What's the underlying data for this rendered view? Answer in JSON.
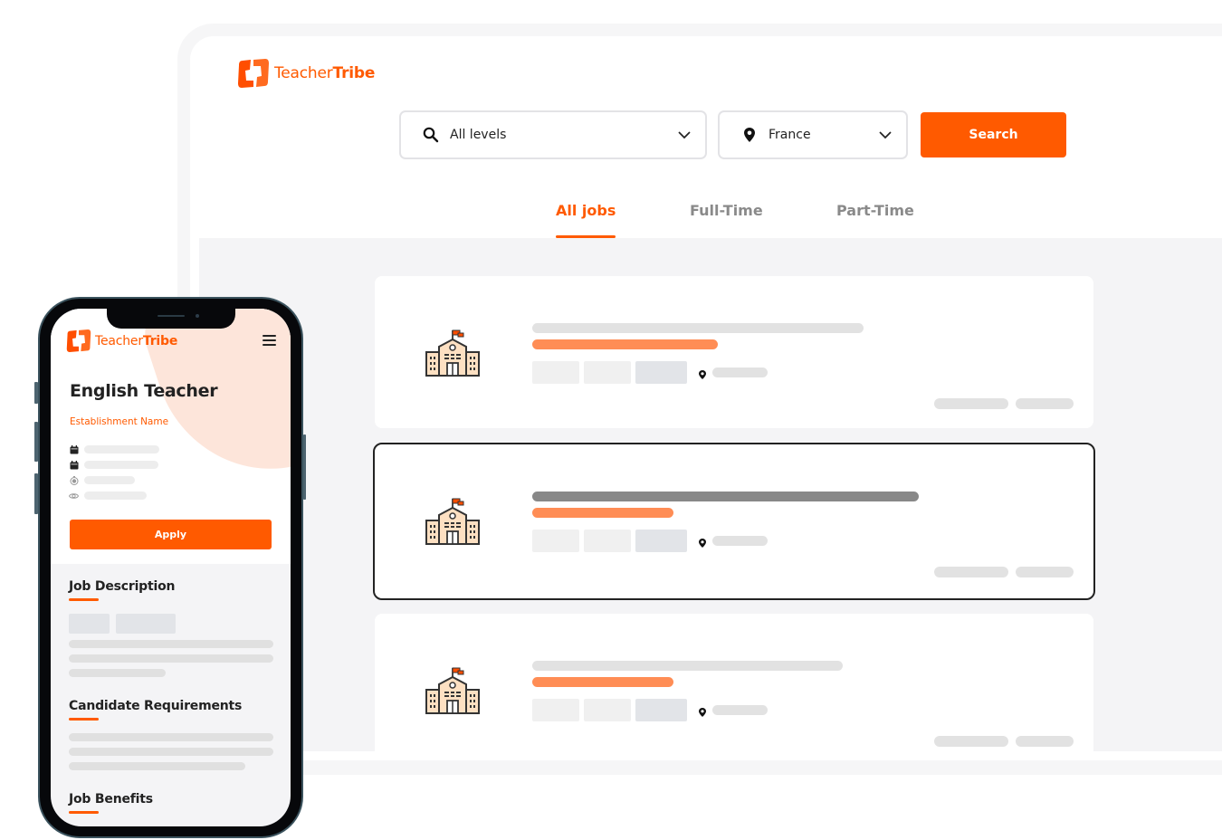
{
  "brand": {
    "name_light": "Teacher",
    "name_bold": "Tribe",
    "accent_color": "#ff5a00"
  },
  "desktop": {
    "search": {
      "level_icon": "search-icon",
      "level_value": "All levels",
      "country_icon": "location-pin-icon",
      "country_value": "France",
      "dropdown_icon": "chevron-down-icon",
      "search_label": "Search"
    },
    "tabs": [
      {
        "label": "All jobs",
        "active": true
      },
      {
        "label": "Full-Time",
        "active": false
      },
      {
        "label": "Part-Time",
        "active": false
      }
    ],
    "job_cards": [
      {
        "icon": "school-building-icon",
        "selected": false,
        "placeholder": true
      },
      {
        "icon": "school-building-icon",
        "selected": true,
        "placeholder": true
      },
      {
        "icon": "school-building-icon",
        "selected": false,
        "placeholder": true
      }
    ]
  },
  "phone": {
    "menu_icon": "hamburger-menu-icon",
    "job_title": "English Teacher",
    "establishment": "Establishment Name",
    "meta_icons": [
      "calendar-icon",
      "calendar-icon",
      "clock-icon",
      "eye-icon"
    ],
    "apply_label": "Apply",
    "sections": [
      {
        "title": "Job Description"
      },
      {
        "title": "Candidate Requirements"
      },
      {
        "title": "Job Benefits"
      }
    ]
  }
}
